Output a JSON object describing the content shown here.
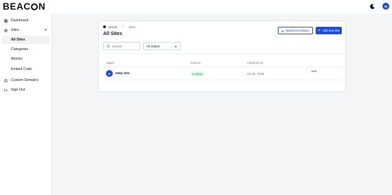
{
  "brand": {
    "logo_text_pre": "BEAC",
    "logo_text_post": "N"
  },
  "header": {
    "avatar_initial": "W"
  },
  "sidebar": {
    "items": [
      {
        "label": "Dashboard"
      },
      {
        "label": "Sites"
      },
      {
        "label": "All Sites"
      },
      {
        "label": "Categories"
      },
      {
        "label": "Articles"
      },
      {
        "label": "Embed Code"
      },
      {
        "label": "Custom Domains"
      },
      {
        "label": "Sign Out"
      }
    ]
  },
  "main": {
    "breadcrumb": {
      "home": "Home",
      "separator": ">",
      "current": "Sites"
    },
    "title": "All Sites",
    "buttons": {
      "stats": "Statistics/Analytics",
      "add": "Add new site",
      "add_icon": "+"
    },
    "search": {
      "placeholder": "Search"
    },
    "filter": {
      "selected": "All Status"
    },
    "table": {
      "headers": [
        "NAME",
        "STATUS",
        "CREATED AT"
      ],
      "rows": [
        {
          "initial": "H",
          "name": "Help Site",
          "status": "Active",
          "created": "Jul 06, 2025",
          "more": "•••"
        }
      ]
    }
  },
  "colors": {
    "accent": "#1d4ed8",
    "active_badge_bg": "#dcfce7",
    "active_badge_text": "#15803d"
  }
}
